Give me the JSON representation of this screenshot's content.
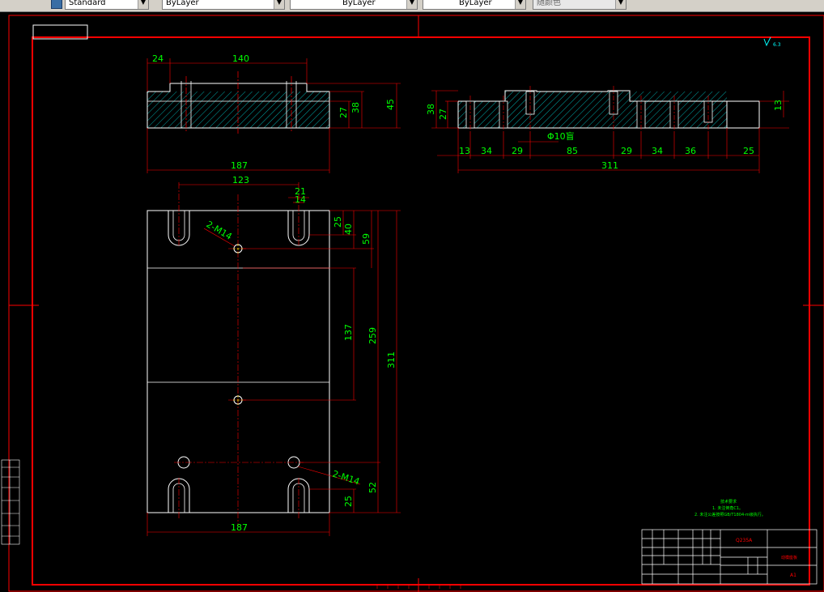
{
  "toolbar": {
    "textstyle": "Standard",
    "layer": "ByLayer",
    "linetype": "ByLayer",
    "lineweight": "ByLayer",
    "plotstyle": "随颜色"
  },
  "drawing": {
    "side_view": {
      "dims": {
        "d24": "24",
        "d140": "140",
        "d38": "38",
        "d27": "27",
        "d45": "45",
        "d187": "187"
      }
    },
    "front_view": {
      "dims": {
        "d13": "13",
        "d34a": "34",
        "d29a": "29",
        "d85": "85",
        "d29b": "29",
        "d34b": "34",
        "d36": "36",
        "d25": "25",
        "d311": "311",
        "d38": "38",
        "d27": "27",
        "d13r": "13",
        "hole": "Φ10盲"
      }
    },
    "plan_view": {
      "dims": {
        "d123": "123",
        "d21": "21",
        "d14": "14",
        "d25t": "25",
        "d40": "40",
        "d59": "59",
        "d137": "137",
        "d259": "259",
        "d311": "311",
        "d52": "52",
        "d25b": "25",
        "d187": "187"
      },
      "labels": {
        "m14_top": "2-M14",
        "m14_bottom": "2-M14"
      }
    },
    "roughness": "6.3",
    "tech_req": {
      "title": "技术要求",
      "line1": "1. 未注倒角C1。",
      "line2": "2. 未注公差按照GB/T1804-m级执行。"
    },
    "title_block": {
      "material": "Q235A",
      "part_name": "动模座板",
      "sheet": "A1"
    }
  }
}
